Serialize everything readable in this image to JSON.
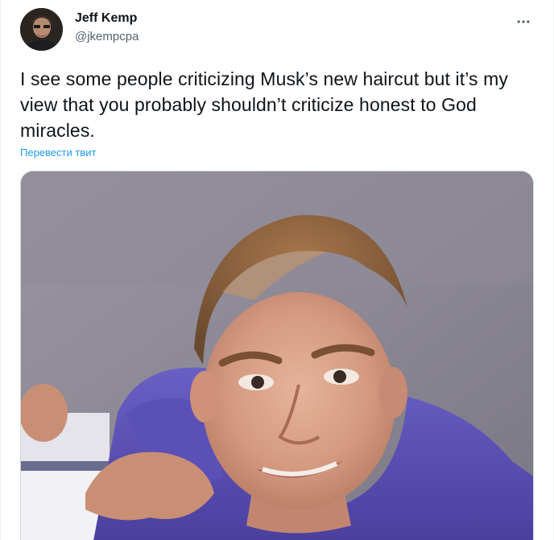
{
  "author": {
    "display_name": "Jeff Kemp",
    "handle": "@jkempcpa"
  },
  "tweet": {
    "text": "I see some people criticizing Musk’s new haircut but it’s my view that you probably shouldn’t criticize honest to God miracles.",
    "translate_label": "Перевести твит"
  },
  "icons": {
    "more": "more-horizontal-icon"
  },
  "colors": {
    "link": "#1d9bf0",
    "secondary_text": "#536471",
    "primary_text": "#0f1419",
    "shirt": "#5a4fb3"
  }
}
